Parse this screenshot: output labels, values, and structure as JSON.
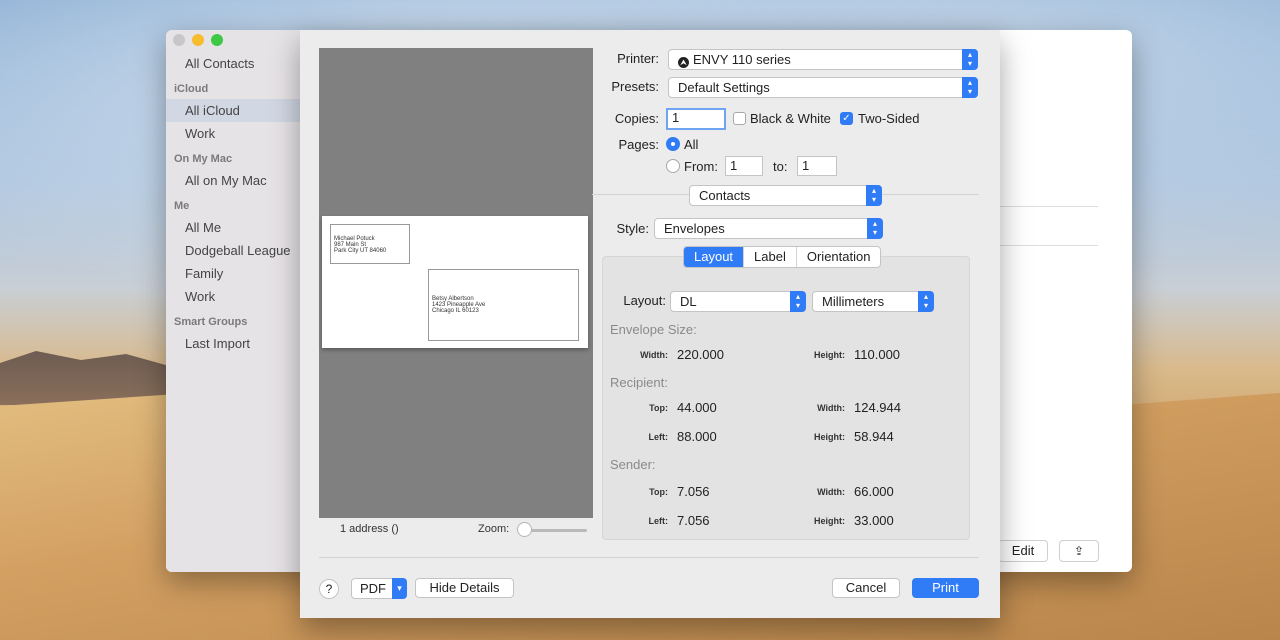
{
  "sidebar": {
    "items": [
      {
        "type": "item",
        "label": "All Contacts"
      },
      {
        "type": "header",
        "label": "iCloud"
      },
      {
        "type": "item",
        "label": "All iCloud",
        "selected": true
      },
      {
        "type": "item",
        "label": "Work"
      },
      {
        "type": "header",
        "label": "On My Mac"
      },
      {
        "type": "item",
        "label": "All on My Mac"
      },
      {
        "type": "header",
        "label": "Me"
      },
      {
        "type": "item",
        "label": "All Me"
      },
      {
        "type": "item",
        "label": "Dodgeball League"
      },
      {
        "type": "item",
        "label": "Family"
      },
      {
        "type": "item",
        "label": "Work"
      },
      {
        "type": "header",
        "label": "Smart Groups"
      },
      {
        "type": "item",
        "label": "Last Import"
      }
    ]
  },
  "contacts_window": {
    "edit_label": "Edit",
    "share_icon": "share-icon"
  },
  "preview": {
    "sender": {
      "line1": "Michael Potuck",
      "line2": "987 Main St",
      "line3": "Park City UT 84060"
    },
    "recipient": {
      "line1": "Betsy Albertson",
      "line2": "1423 Pineapple Ave",
      "line3": "Chicago IL 60123"
    },
    "address_count": "1 address  ()",
    "zoom_label": "Zoom:"
  },
  "print": {
    "printer_label": "Printer:",
    "printer_value": "ENVY 110 series",
    "presets_label": "Presets:",
    "presets_value": "Default Settings",
    "copies_label": "Copies:",
    "copies_value": "1",
    "bw_label": "Black & White",
    "two_sided_label": "Two-Sided",
    "pages_label": "Pages:",
    "all_label": "All",
    "from_label": "From:",
    "from_value": "1",
    "to_label": "to:",
    "to_value": "1",
    "app_section": "Contacts",
    "style_label": "Style:",
    "style_value": "Envelopes",
    "tabs": [
      "Layout",
      "Label",
      "Orientation"
    ],
    "layout_label": "Layout:",
    "layout_value": "DL",
    "units_value": "Millimeters",
    "envelope_size_title": "Envelope Size:",
    "envelope_width_label": "Width:",
    "envelope_width": "220.000",
    "envelope_height_label": "Height:",
    "envelope_height": "110.000",
    "recipient_title": "Recipient:",
    "recipient_top_label": "Top:",
    "recipient_top": "44.000",
    "recipient_width_label": "Width:",
    "recipient_width": "124.944",
    "recipient_left_label": "Left:",
    "recipient_left": "88.000",
    "recipient_height_label": "Height:",
    "recipient_height": "58.944",
    "sender_title": "Sender:",
    "sender_top_label": "Top:",
    "sender_top": "7.056",
    "sender_width_label": "Width:",
    "sender_width": "66.000",
    "sender_left_label": "Left:",
    "sender_left": "7.056",
    "sender_height_label": "Height:",
    "sender_height": "33.000",
    "help_label": "?",
    "pdf_label": "PDF",
    "hide_details_label": "Hide Details",
    "cancel_label": "Cancel",
    "print_label": "Print"
  },
  "colors": {
    "accent": "#2f7cf6",
    "sidebar_selected": "#d1d7e3"
  }
}
